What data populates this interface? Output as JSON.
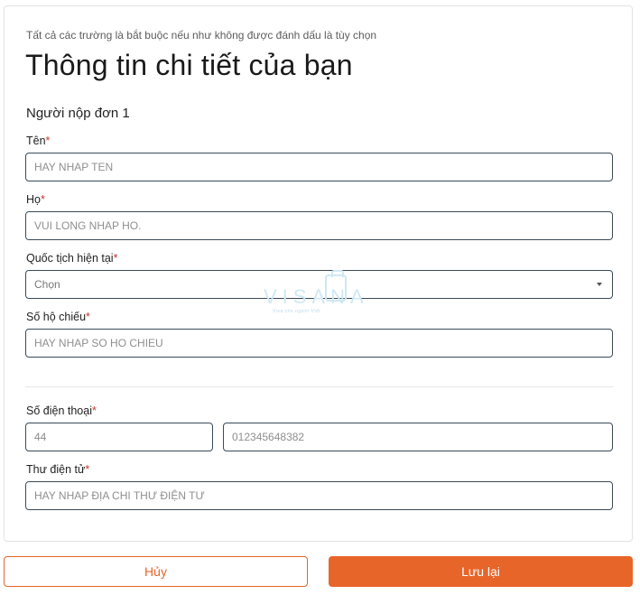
{
  "form": {
    "note": "Tất cả các trường là bắt buộc nếu như không được đánh dấu là tùy chọn",
    "title": "Thông tin chi tiết của bạn",
    "applicant_label": "Người nộp đơn 1",
    "required_mark": "*",
    "fields": {
      "first_name": {
        "label": "Tên",
        "placeholder": "HAY NHAP TEN"
      },
      "last_name": {
        "label": "Họ",
        "placeholder": "VUI LONG NHAP HO."
      },
      "nationality": {
        "label": "Quốc tịch hiện tại",
        "selected": "Chọn"
      },
      "passport": {
        "label": "Số hộ chiếu",
        "placeholder": "HAY NHAP SO HO CHIEU"
      },
      "phone": {
        "label": "Số điện thoại",
        "code_value": "44",
        "number_placeholder": "012345648382"
      },
      "email": {
        "label": "Thư điện tử",
        "placeholder": "HAY NHAP ĐỊA CHI THƯ ĐIỆN TƯ"
      }
    }
  },
  "watermark": {
    "text": "VISANA",
    "subtext": "Visa cho người Việt"
  },
  "actions": {
    "cancel_label": "Hủy",
    "save_label": "Lưu lại"
  },
  "colors": {
    "accent": "#e8652a",
    "field_border": "#3b4a57",
    "required": "#c0392b"
  }
}
